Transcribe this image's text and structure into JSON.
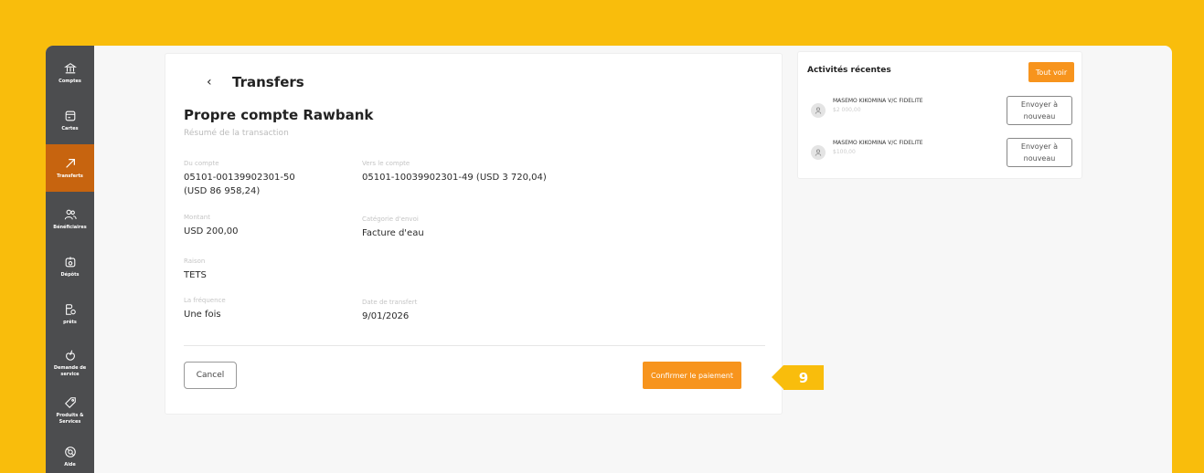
{
  "sidebar": {
    "items": [
      {
        "label": "Comptes",
        "icon": "bank-icon",
        "active": false
      },
      {
        "label": "Cartes",
        "icon": "card-icon",
        "active": false
      },
      {
        "label": "Transferts",
        "icon": "transfer-arrow-icon",
        "active": true
      },
      {
        "label": "Bénéficiaires",
        "icon": "users-icon",
        "active": false
      },
      {
        "label": "Dépôts",
        "icon": "deposit-icon",
        "active": false
      },
      {
        "label": "prêts",
        "icon": "loan-icon",
        "active": false
      },
      {
        "label": "Demande de service",
        "icon": "service-request-icon",
        "active": false
      },
      {
        "label": "Produits & Services",
        "icon": "products-icon",
        "active": false
      },
      {
        "label": "Aide",
        "icon": "help-icon",
        "active": false
      }
    ]
  },
  "transfer": {
    "page_title": "Transfers",
    "section_title": "Propre compte Rawbank",
    "section_subtitle": "Résumé de la transaction",
    "from_account": {
      "label": "Du compte",
      "value": "05101-00139902301-50",
      "balance": "(USD 86 958,24)"
    },
    "to_account": {
      "label": "Vers le compte",
      "value": "05101-10039902301-49 (USD 3 720,04)"
    },
    "amount": {
      "label": "Montant",
      "value": "USD 200,00"
    },
    "category": {
      "label": "Catégorie d'envoi",
      "value": "Facture d'eau"
    },
    "reason": {
      "label": "Raison",
      "value": "TETS"
    },
    "frequency": {
      "label": "La fréquence",
      "value": "Une fois"
    },
    "transfer_date": {
      "label": "Date de transfert",
      "value": "9/01/2026"
    },
    "cancel_label": "Cancel",
    "confirm_label": "Confirmer le paiement"
  },
  "step_badge": "9",
  "activities": {
    "title": "Activités récentes",
    "see_all_label": "Tout voir",
    "items": [
      {
        "name": "MASEMO KIKOMINA V/C FIDELITE",
        "amount": "$2 000,00",
        "action_line1": "Envoyer à",
        "action_line2": "nouveau"
      },
      {
        "name": "MASEMO KIKOMINA V/C FIDELITE",
        "amount": "$100,00",
        "action_line1": "Envoyer à",
        "action_line2": "nouveau"
      }
    ]
  },
  "colors": {
    "accent": "#f7941d",
    "background": "#f9bd0c",
    "sidebar": "#4c4d4f",
    "active_nav": "#c7640f"
  }
}
